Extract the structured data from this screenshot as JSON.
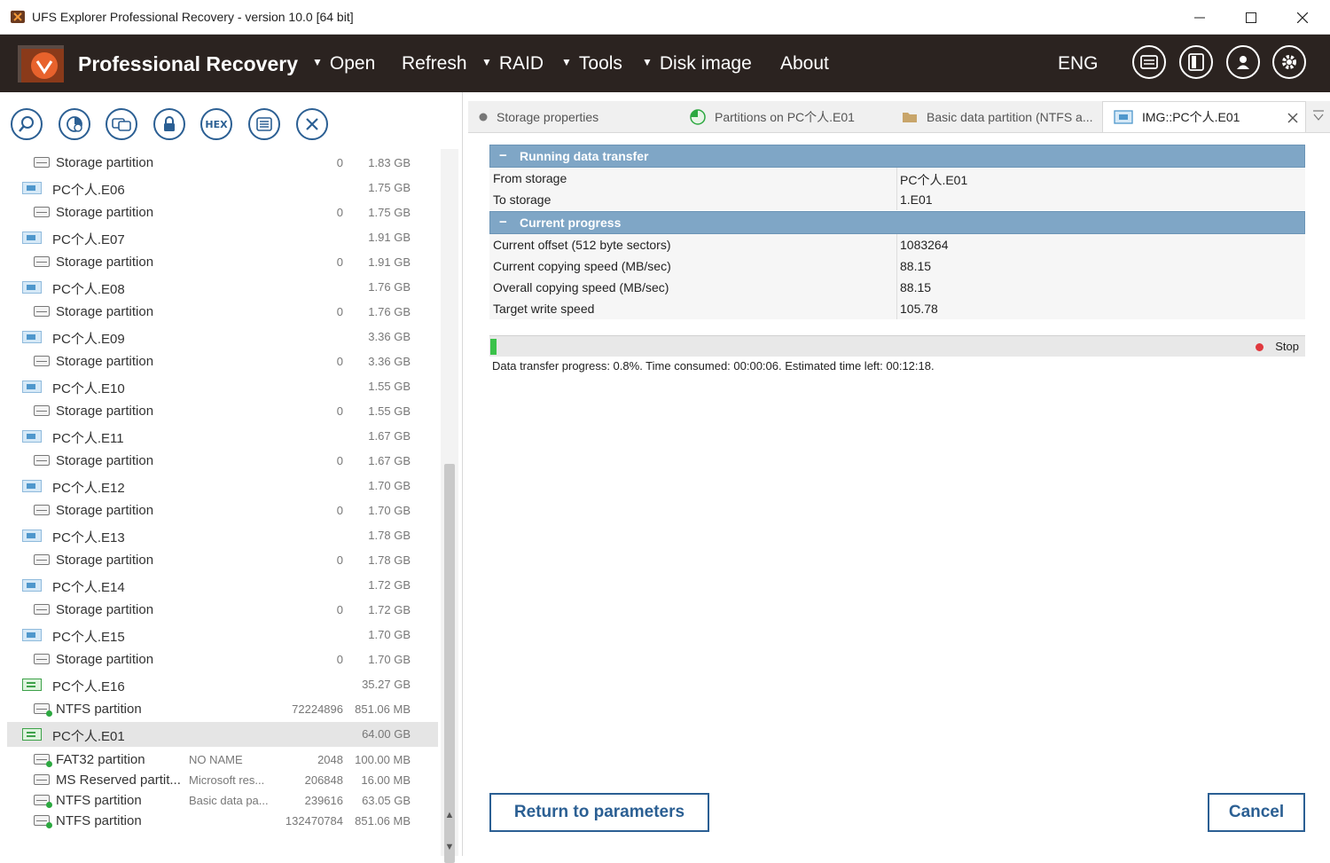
{
  "window": {
    "title": "UFS Explorer Professional Recovery - version 10.0 [64 bit]",
    "controls": [
      "minimize-icon",
      "maximize-icon",
      "close-icon"
    ]
  },
  "header": {
    "brand": "Professional Recovery",
    "menu": [
      {
        "label": "Open",
        "has_dropdown": true
      },
      {
        "label": "Refresh",
        "has_dropdown": false
      },
      {
        "label": "RAID",
        "has_dropdown": true
      },
      {
        "label": "Tools",
        "has_dropdown": true
      },
      {
        "label": "Disk image",
        "has_dropdown": true
      },
      {
        "label": "About",
        "has_dropdown": false
      }
    ],
    "language": "ENG",
    "icons": [
      "storage-icon",
      "panel-icon",
      "user-icon",
      "settings-icon"
    ]
  },
  "toolbar": {
    "buttons": [
      "search-icon",
      "scan-icon",
      "copy-icon",
      "lock-icon",
      "hex-icon",
      "list-icon",
      "close-icon"
    ],
    "hex_label": "HEX"
  },
  "tree": [
    {
      "type": "partition",
      "name": "Storage partition",
      "label": "",
      "start": "0",
      "size": "1.83 GB"
    },
    {
      "type": "drive",
      "name": "PC个人.E06",
      "label": "",
      "start": "",
      "size": "1.75 GB"
    },
    {
      "type": "partition",
      "name": "Storage partition",
      "label": "",
      "start": "0",
      "size": "1.75 GB"
    },
    {
      "type": "drive",
      "name": "PC个人.E07",
      "label": "",
      "start": "",
      "size": "1.91 GB"
    },
    {
      "type": "partition",
      "name": "Storage partition",
      "label": "",
      "start": "0",
      "size": "1.91 GB"
    },
    {
      "type": "drive",
      "name": "PC个人.E08",
      "label": "",
      "start": "",
      "size": "1.76 GB"
    },
    {
      "type": "partition",
      "name": "Storage partition",
      "label": "",
      "start": "0",
      "size": "1.76 GB"
    },
    {
      "type": "drive",
      "name": "PC个人.E09",
      "label": "",
      "start": "",
      "size": "3.36 GB"
    },
    {
      "type": "partition",
      "name": "Storage partition",
      "label": "",
      "start": "0",
      "size": "3.36 GB"
    },
    {
      "type": "drive",
      "name": "PC个人.E10",
      "label": "",
      "start": "",
      "size": "1.55 GB"
    },
    {
      "type": "partition",
      "name": "Storage partition",
      "label": "",
      "start": "0",
      "size": "1.55 GB"
    },
    {
      "type": "drive",
      "name": "PC个人.E11",
      "label": "",
      "start": "",
      "size": "1.67 GB"
    },
    {
      "type": "partition",
      "name": "Storage partition",
      "label": "",
      "start": "0",
      "size": "1.67 GB"
    },
    {
      "type": "drive",
      "name": "PC个人.E12",
      "label": "",
      "start": "",
      "size": "1.70 GB"
    },
    {
      "type": "partition",
      "name": "Storage partition",
      "label": "",
      "start": "0",
      "size": "1.70 GB"
    },
    {
      "type": "drive",
      "name": "PC个人.E13",
      "label": "",
      "start": "",
      "size": "1.78 GB"
    },
    {
      "type": "partition",
      "name": "Storage partition",
      "label": "",
      "start": "0",
      "size": "1.78 GB"
    },
    {
      "type": "drive",
      "name": "PC个人.E14",
      "label": "",
      "start": "",
      "size": "1.72 GB"
    },
    {
      "type": "partition",
      "name": "Storage partition",
      "label": "",
      "start": "0",
      "size": "1.72 GB"
    },
    {
      "type": "drive",
      "name": "PC个人.E15",
      "label": "",
      "start": "",
      "size": "1.70 GB"
    },
    {
      "type": "partition",
      "name": "Storage partition",
      "label": "",
      "start": "0",
      "size": "1.70 GB"
    },
    {
      "type": "drive-green",
      "name": "PC个人.E16",
      "label": "",
      "start": "",
      "size": "35.27 GB"
    },
    {
      "type": "ntfs",
      "name": "NTFS partition",
      "label": "",
      "start": "72224896",
      "size": "851.06 MB"
    },
    {
      "type": "drive-green",
      "name": "PC个人.E01",
      "label": "",
      "start": "",
      "size": "64.00 GB",
      "selected": true
    },
    {
      "type": "ntfs",
      "name": "FAT32 partition",
      "label": "NO NAME",
      "start": "2048",
      "size": "100.00 MB"
    },
    {
      "type": "partition",
      "name": "MS Reserved partit...",
      "label": "Microsoft res...",
      "start": "206848",
      "size": "16.00 MB"
    },
    {
      "type": "ntfs",
      "name": "NTFS partition",
      "label": "Basic data pa...",
      "start": "239616",
      "size": "63.05 GB"
    },
    {
      "type": "ntfs",
      "name": "NTFS partition",
      "label": "",
      "start": "132470784",
      "size": "851.06 MB"
    }
  ],
  "tabs": [
    {
      "label": "Storage properties",
      "icon": "dot-icon"
    },
    {
      "label": "Partitions on PC个人.E01",
      "icon": "pie-icon"
    },
    {
      "label": "Basic data partition (NTFS a...",
      "icon": "folder-icon"
    },
    {
      "label": "IMG::PC个人.E01",
      "icon": "image-icon",
      "active": true
    }
  ],
  "transfer": {
    "section1": "Running data transfer",
    "rows1": [
      {
        "key": "From storage",
        "value": "PC个人.E01"
      },
      {
        "key": "To storage",
        "value": "1.E01"
      }
    ],
    "section2": "Current progress",
    "rows2": [
      {
        "key": "Current offset (512 byte sectors)",
        "value": "1083264"
      },
      {
        "key": "Current copying speed (MB/sec)",
        "value": "88.15"
      },
      {
        "key": "Overall copying speed (MB/sec)",
        "value": "88.15"
      },
      {
        "key": "Target write speed",
        "value": "105.78"
      }
    ],
    "progress_fraction": 0.008,
    "stop_label": "Stop",
    "status": "Data transfer progress: 0.8%. Time consumed: 00:00:06. Estimated time left: 00:12:18."
  },
  "buttons": {
    "return": "Return to parameters",
    "cancel": "Cancel"
  },
  "colors": {
    "header_bg": "#2b2320",
    "accent": "#2b5f93",
    "section_bg": "#7fa6c6",
    "progress": "#3bc24a",
    "stop": "#e0393e"
  }
}
